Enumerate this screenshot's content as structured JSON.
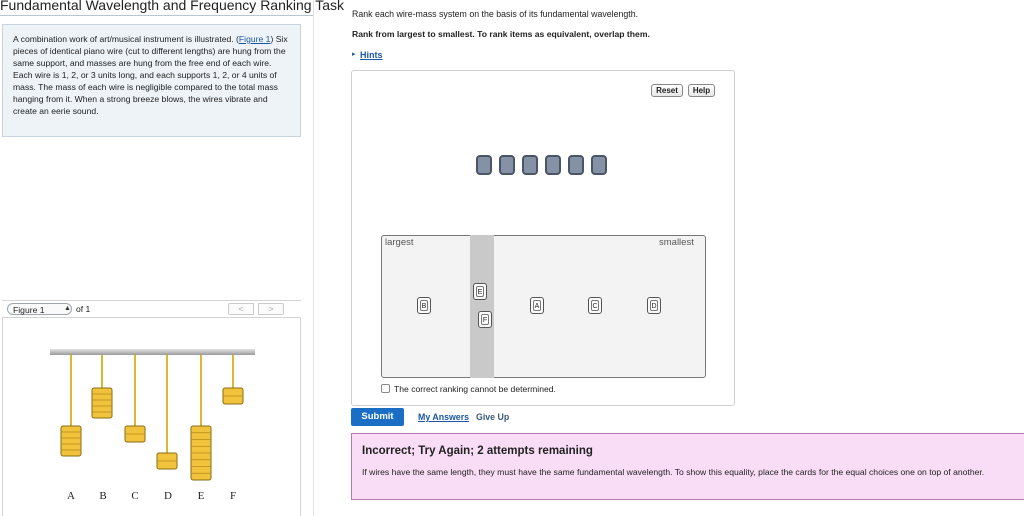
{
  "title": "Fundamental Wavelength and Frequency Ranking Task",
  "problem": {
    "text_before_link": "A combination work of art/musical instrument is illustrated. (",
    "figure_link": "Figure 1",
    "text_after_link": ") Six pieces of identical piano wire (cut to different lengths) are hung from the same support, and masses are hung from the free end of each wire. Each wire is 1, 2, or 3 units long, and each supports 1, 2, or 4 units of mass. The mass of each wire is negligible compared to the total mass hanging from it. When a strong breeze blows, the wires vibrate and create an eerie sound."
  },
  "figure_nav": {
    "selected": "Figure 1",
    "of_text": "of 1",
    "prev": "<",
    "next": ">"
  },
  "figure": {
    "wire_labels": [
      "A",
      "B",
      "C",
      "D",
      "E",
      "F"
    ],
    "wire_color": "#d9b832",
    "mass_color": "#f1c23c"
  },
  "task": {
    "instruction": "Rank each wire-mass system on the basis of its fundamental wavelength.",
    "rank_order": "Rank from largest to smallest. To rank items as equivalent, overlap them.",
    "hints_arrow": "▸",
    "hints": "Hints"
  },
  "widget": {
    "reset": "Reset",
    "help": "Help",
    "empty_slot_count": 6,
    "largest": "largest",
    "smallest": "smallest",
    "cards": [
      "B",
      "E",
      "F",
      "A",
      "C",
      "D"
    ],
    "cannot_determine": "The correct ranking cannot be determined."
  },
  "actions": {
    "submit": "Submit",
    "my_answers": "My Answers",
    "give_up": "Give Up"
  },
  "feedback": {
    "title": "Incorrect; Try Again; 2 attempts remaining",
    "body": "If wires have the same length, they must have the same fundamental wavelength. To show this equality, place the cards for the equal choices one on top of another."
  },
  "colors": {
    "link": "#1a57a7",
    "submit": "#1a6ec4",
    "feedback_bg": "#f9ddf6",
    "feedback_border": "#b57ab0",
    "problem_bg": "#eef3f7"
  }
}
